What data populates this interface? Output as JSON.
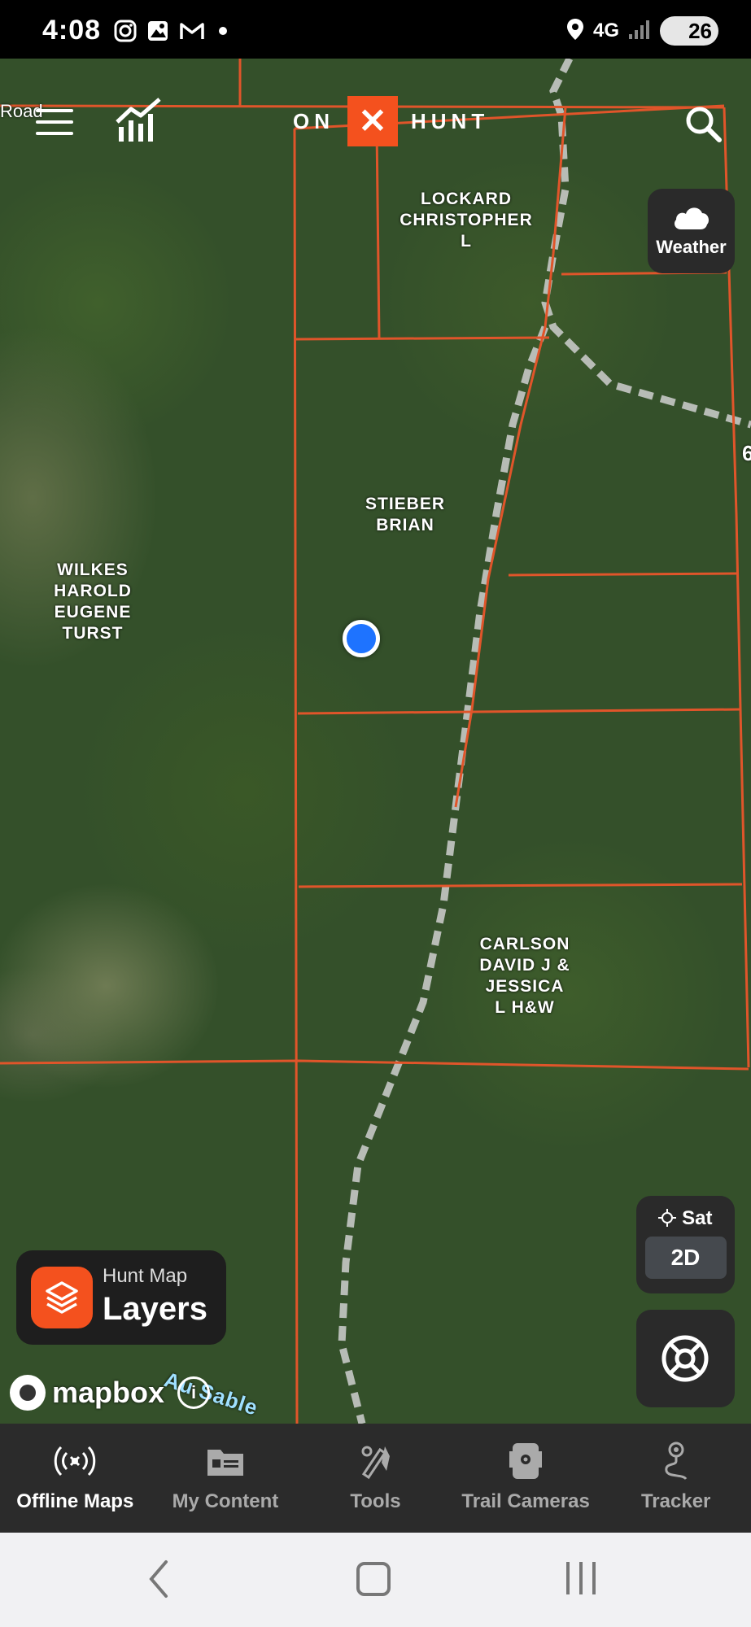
{
  "status_bar": {
    "time": "4:08",
    "network": "4G",
    "battery": "26"
  },
  "app": {
    "logo_left": "ON",
    "logo_mark": "✕",
    "logo_right": "HUNT"
  },
  "map": {
    "road_label": "Road",
    "parcels": [
      {
        "owner": "LOCKARD\nCHRISTOPHER\nL"
      },
      {
        "owner": "STIEBER\nBRIAN"
      },
      {
        "owner": "WILKES\nHAROLD\nEUGENE\nTURST"
      },
      {
        "owner": "CARLSON\nDAVID J &\nJESSICA\nL H&W"
      }
    ],
    "water_label": "Au Sable",
    "edge_label": "6"
  },
  "weather_button": {
    "label": "Weather",
    "icon": "cloud-icon"
  },
  "basemap_toggle": {
    "basemap": "Sat",
    "mode": "2D"
  },
  "layers_button": {
    "subtitle": "Hunt Map",
    "title": "Layers"
  },
  "attribution": {
    "text": "mapbox"
  },
  "bottom_nav": [
    {
      "label": "Offline Maps",
      "icon": "offline-signal-icon",
      "active": true
    },
    {
      "label": "My Content",
      "icon": "folder-icon",
      "active": false
    },
    {
      "label": "Tools",
      "icon": "tools-icon",
      "active": false
    },
    {
      "label": "Trail Cameras",
      "icon": "trail-camera-icon",
      "active": false
    },
    {
      "label": "Tracker",
      "icon": "tracker-icon",
      "active": false
    }
  ],
  "colors": {
    "accent": "#f4511e",
    "parcel_line": "#e0552a",
    "location_dot": "#1e73ff"
  }
}
